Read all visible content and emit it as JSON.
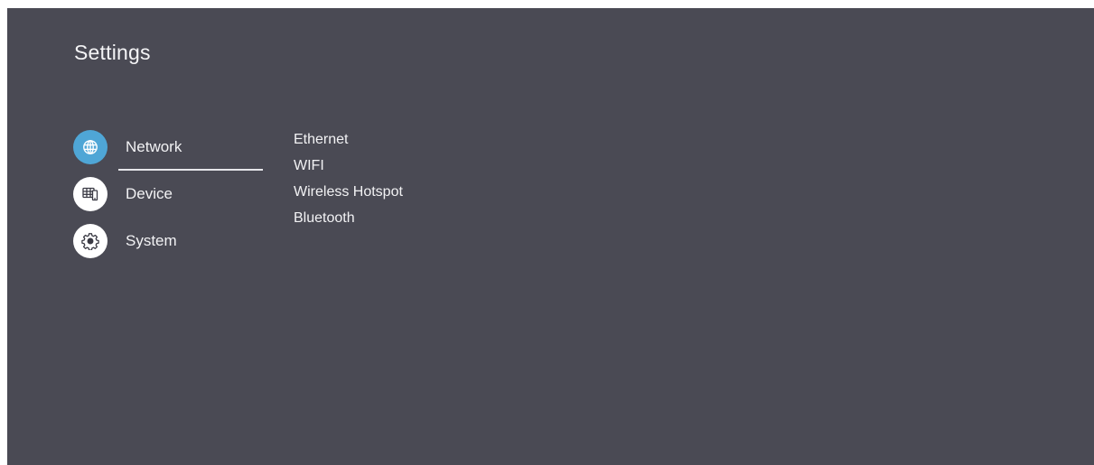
{
  "header": {
    "title": "Settings"
  },
  "sidebar": {
    "items": [
      {
        "label": "Network",
        "icon": "globe-icon",
        "active": true
      },
      {
        "label": "Device",
        "icon": "device-icon",
        "active": false
      },
      {
        "label": "System",
        "icon": "gear-icon",
        "active": false
      }
    ]
  },
  "submenu": {
    "items": [
      {
        "label": "Ethernet"
      },
      {
        "label": "WIFI"
      },
      {
        "label": "Wireless Hotspot"
      },
      {
        "label": "Bluetooth"
      }
    ]
  },
  "colors": {
    "background": "#4a4a54",
    "accent": "#4fa6d6",
    "text": "#f2f2f4"
  }
}
